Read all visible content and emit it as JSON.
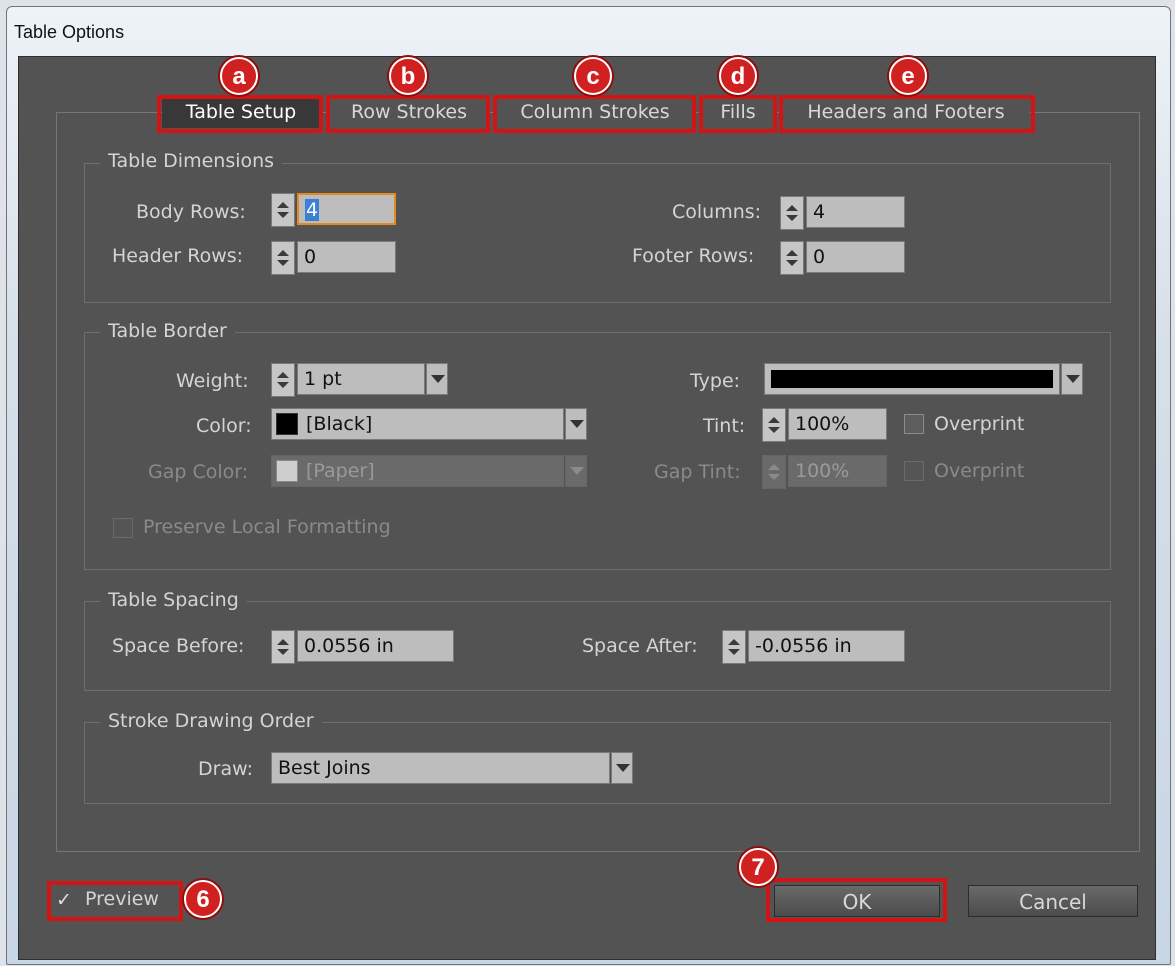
{
  "window": {
    "title": "Table Options"
  },
  "tabs": [
    {
      "label": "Table Setup",
      "badge": "a",
      "active": true
    },
    {
      "label": "Row Strokes",
      "badge": "b"
    },
    {
      "label": "Column Strokes",
      "badge": "c"
    },
    {
      "label": "Fills",
      "badge": "d"
    },
    {
      "label": "Headers and Footers",
      "badge": "e"
    }
  ],
  "table_dimensions": {
    "title": "Table Dimensions",
    "body_rows": {
      "label": "Body Rows:",
      "value": "4"
    },
    "columns": {
      "label": "Columns:",
      "value": "4"
    },
    "header_rows": {
      "label": "Header Rows:",
      "value": "0"
    },
    "footer_rows": {
      "label": "Footer Rows:",
      "value": "0"
    }
  },
  "table_border": {
    "title": "Table Border",
    "weight": {
      "label": "Weight:",
      "value": "1 pt"
    },
    "type": {
      "label": "Type:"
    },
    "color": {
      "label": "Color:",
      "value": "[Black]",
      "swatch": "#000000"
    },
    "tint": {
      "label": "Tint:",
      "value": "100%"
    },
    "overprint": {
      "label": "Overprint"
    },
    "gap_color": {
      "label": "Gap Color:",
      "value": "[Paper]",
      "swatch": "#d9d9d9"
    },
    "gap_tint": {
      "label": "Gap Tint:",
      "value": "100%"
    },
    "gap_overprint": {
      "label": "Overprint"
    },
    "preserve": {
      "label": "Preserve Local Formatting"
    }
  },
  "table_spacing": {
    "title": "Table Spacing",
    "space_before": {
      "label": "Space Before:",
      "value": "0.0556 in"
    },
    "space_after": {
      "label": "Space After:",
      "value": "-0.0556 in"
    }
  },
  "stroke_order": {
    "title": "Stroke Drawing Order",
    "draw": {
      "label": "Draw:",
      "value": "Best Joins"
    }
  },
  "footer": {
    "preview": {
      "label": "Preview",
      "check": "✓",
      "badge": "6"
    },
    "ok": {
      "label": "OK",
      "badge": "7"
    },
    "cancel": {
      "label": "Cancel"
    }
  },
  "colors": {
    "dialog_bg": "#535353",
    "accent_red": "#d21414",
    "focus_orange": "#e58a1f"
  }
}
